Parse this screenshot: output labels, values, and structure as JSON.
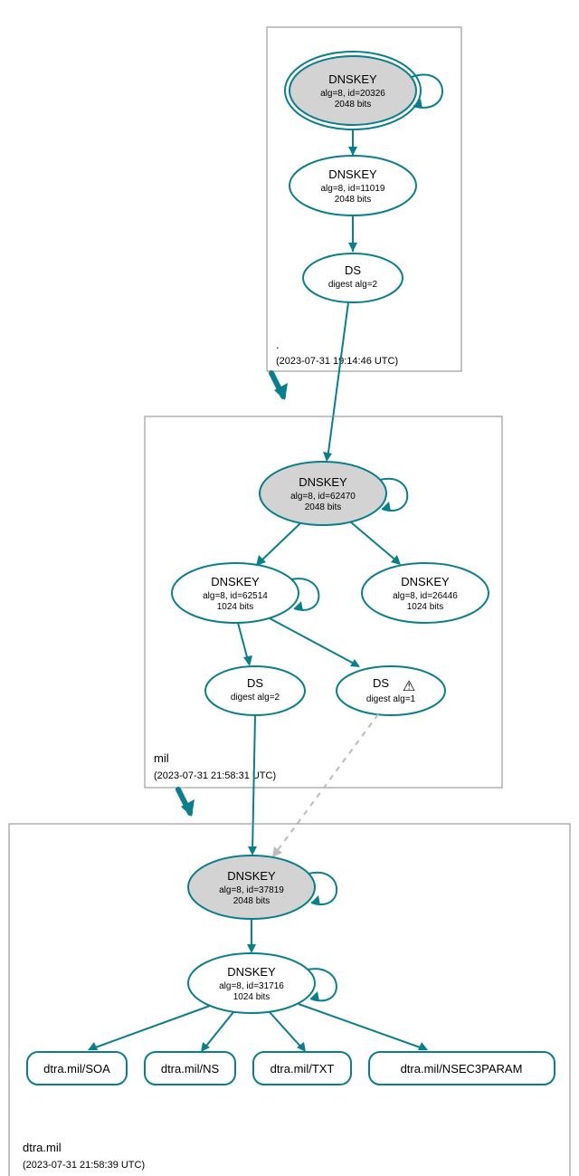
{
  "zones": {
    "root": {
      "label": ".",
      "timestamp": "(2023-07-31 19:14:46 UTC)"
    },
    "mil": {
      "label": "mil",
      "timestamp": "(2023-07-31 21:58:31 UTC)"
    },
    "dtra": {
      "label": "dtra.mil",
      "timestamp": "(2023-07-31 21:58:39 UTC)"
    }
  },
  "nodes": {
    "root_ksk": {
      "title": "DNSKEY",
      "l1": "alg=8, id=20326",
      "l2": "2048 bits"
    },
    "root_zsk": {
      "title": "DNSKEY",
      "l1": "alg=8, id=11019",
      "l2": "2048 bits"
    },
    "root_ds": {
      "title": "DS",
      "l1": "digest alg=2"
    },
    "mil_ksk": {
      "title": "DNSKEY",
      "l1": "alg=8, id=62470",
      "l2": "2048 bits"
    },
    "mil_zsk": {
      "title": "DNSKEY",
      "l1": "alg=8, id=62514",
      "l2": "1024 bits"
    },
    "mil_zsk2": {
      "title": "DNSKEY",
      "l1": "alg=8, id=26446",
      "l2": "1024 bits"
    },
    "mil_ds1": {
      "title": "DS",
      "l1": "digest alg=2"
    },
    "mil_ds2": {
      "title": "DS",
      "l1": "digest alg=1",
      "warn": "⚠"
    },
    "dtra_ksk": {
      "title": "DNSKEY",
      "l1": "alg=8, id=37819",
      "l2": "2048 bits"
    },
    "dtra_zsk": {
      "title": "DNSKEY",
      "l1": "alg=8, id=31716",
      "l2": "1024 bits"
    },
    "rr_soa": {
      "label": "dtra.mil/SOA"
    },
    "rr_ns": {
      "label": "dtra.mil/NS"
    },
    "rr_txt": {
      "label": "dtra.mil/TXT"
    },
    "rr_nsec3": {
      "label": "dtra.mil/NSEC3PARAM"
    }
  },
  "chart_data": {
    "type": "dnssec-authentication-graph",
    "zones": [
      {
        "name": ".",
        "timestamp": "2023-07-31 19:14:46 UTC",
        "keys": [
          {
            "type": "DNSKEY",
            "alg": 8,
            "id": 20326,
            "bits": 2048,
            "role": "KSK",
            "trust_anchor": true
          },
          {
            "type": "DNSKEY",
            "alg": 8,
            "id": 11019,
            "bits": 2048,
            "role": "ZSK"
          }
        ],
        "ds_to_child": [
          {
            "digest_alg": 2
          }
        ]
      },
      {
        "name": "mil",
        "timestamp": "2023-07-31 21:58:31 UTC",
        "keys": [
          {
            "type": "DNSKEY",
            "alg": 8,
            "id": 62470,
            "bits": 2048,
            "role": "KSK"
          },
          {
            "type": "DNSKEY",
            "alg": 8,
            "id": 62514,
            "bits": 1024,
            "role": "ZSK"
          },
          {
            "type": "DNSKEY",
            "alg": 8,
            "id": 26446,
            "bits": 1024,
            "role": "ZSK"
          }
        ],
        "ds_to_child": [
          {
            "digest_alg": 2
          },
          {
            "digest_alg": 1,
            "warning": true
          }
        ]
      },
      {
        "name": "dtra.mil",
        "timestamp": "2023-07-31 21:58:39 UTC",
        "keys": [
          {
            "type": "DNSKEY",
            "alg": 8,
            "id": 37819,
            "bits": 2048,
            "role": "KSK"
          },
          {
            "type": "DNSKEY",
            "alg": 8,
            "id": 31716,
            "bits": 1024,
            "role": "ZSK"
          }
        ],
        "rrsets": [
          "dtra.mil/SOA",
          "dtra.mil/NS",
          "dtra.mil/TXT",
          "dtra.mil/NSEC3PARAM"
        ]
      }
    ],
    "edges": [
      {
        "from": "./DNSKEY/20326",
        "to": "./DNSKEY/20326",
        "kind": "self-sign"
      },
      {
        "from": "./DNSKEY/20326",
        "to": "./DNSKEY/11019",
        "kind": "sign"
      },
      {
        "from": "./DNSKEY/11019",
        "to": "mil/DS/alg2",
        "kind": "sign"
      },
      {
        "from": "mil/DS/alg2",
        "to": "mil/DNSKEY/62470",
        "kind": "ds"
      },
      {
        "from": "mil/DNSKEY/62470",
        "to": "mil/DNSKEY/62470",
        "kind": "self-sign"
      },
      {
        "from": "mil/DNSKEY/62470",
        "to": "mil/DNSKEY/62514",
        "kind": "sign"
      },
      {
        "from": "mil/DNSKEY/62470",
        "to": "mil/DNSKEY/26446",
        "kind": "sign"
      },
      {
        "from": "mil/DNSKEY/62514",
        "to": "mil/DNSKEY/62514",
        "kind": "self-sign"
      },
      {
        "from": "mil/DNSKEY/62514",
        "to": "dtra.mil/DS/alg2",
        "kind": "sign"
      },
      {
        "from": "mil/DNSKEY/62514",
        "to": "dtra.mil/DS/alg1",
        "kind": "sign"
      },
      {
        "from": "dtra.mil/DS/alg2",
        "to": "dtra.mil/DNSKEY/37819",
        "kind": "ds"
      },
      {
        "from": "dtra.mil/DS/alg1",
        "to": "dtra.mil/DNSKEY/37819",
        "kind": "ds",
        "warning": true
      },
      {
        "from": "dtra.mil/DNSKEY/37819",
        "to": "dtra.mil/DNSKEY/37819",
        "kind": "self-sign"
      },
      {
        "from": "dtra.mil/DNSKEY/37819",
        "to": "dtra.mil/DNSKEY/31716",
        "kind": "sign"
      },
      {
        "from": "dtra.mil/DNSKEY/31716",
        "to": "dtra.mil/DNSKEY/31716",
        "kind": "self-sign"
      },
      {
        "from": "dtra.mil/DNSKEY/31716",
        "to": "dtra.mil/SOA",
        "kind": "sign"
      },
      {
        "from": "dtra.mil/DNSKEY/31716",
        "to": "dtra.mil/NS",
        "kind": "sign"
      },
      {
        "from": "dtra.mil/DNSKEY/31716",
        "to": "dtra.mil/TXT",
        "kind": "sign"
      },
      {
        "from": "dtra.mil/DNSKEY/31716",
        "to": "dtra.mil/NSEC3PARAM",
        "kind": "sign"
      }
    ]
  }
}
